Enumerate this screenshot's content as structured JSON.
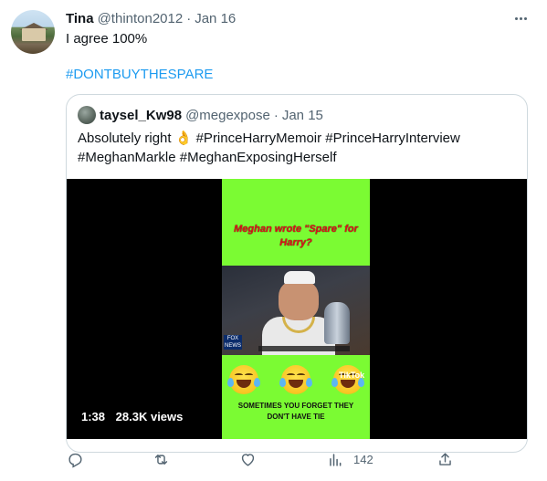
{
  "tweet": {
    "author_name": "Tina",
    "handle": "@thinton2012",
    "separator": "·",
    "date": "Jan 16",
    "text": "I agree 100%",
    "hashtag": "#DONTBUYTHESPARE"
  },
  "quote": {
    "author_name": "taysel_Kw98",
    "handle": "@megexpose",
    "separator": "·",
    "date": "Jan 15",
    "text_start": "Absolutely right ",
    "emoji": "👌",
    "tag1": "#PrinceHarryMemoir",
    "tag2": "#PrinceHarryInterview",
    "tag3": "#MeghanMarkle",
    "tag4": "#MeghanExposingHerself",
    "video": {
      "caption_top": "Meghan wrote \"Spare\" for Harry?",
      "caption_bottom": "SOMETIMES YOU FORGET THEY DON'T HAVE TIE",
      "tiktok_label": "TikTok",
      "news_logo": "FOX NEWS",
      "duration": "1:38",
      "views": "28.3K views"
    }
  },
  "actions": {
    "reply_icon": "reply-icon",
    "retweet_icon": "retweet-icon",
    "like_icon": "like-icon",
    "views_icon": "analytics-icon",
    "views_count": "142",
    "share_icon": "share-icon"
  },
  "colors": {
    "accent": "#1d9bf0",
    "muted": "#536471",
    "border": "#cfd9de",
    "video_green": "#7bfb33"
  }
}
